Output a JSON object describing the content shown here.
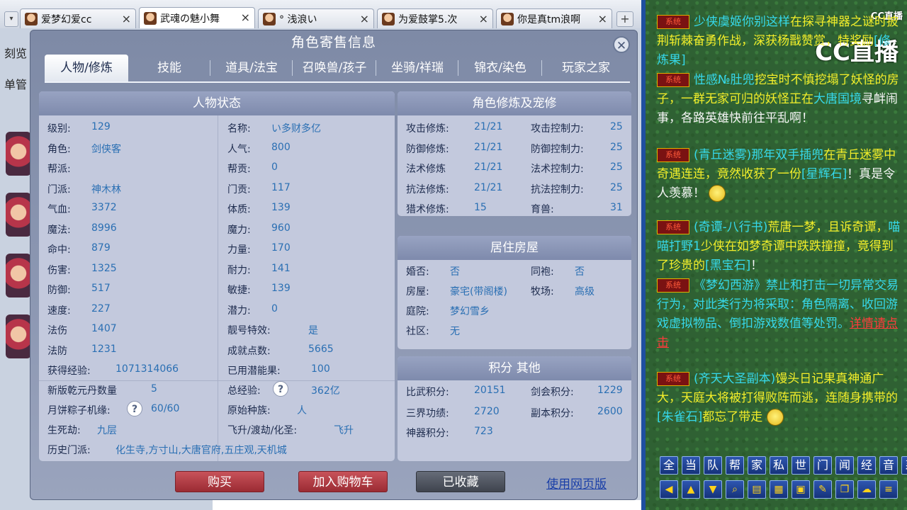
{
  "browser_tabs": [
    {
      "label": "爱梦幻爱cc",
      "active": false
    },
    {
      "label": "武魂の魅小舞",
      "active": true
    },
    {
      "label": "° 浅浪い",
      "active": false
    },
    {
      "label": "为爱鼓掌5.次",
      "active": false
    },
    {
      "label": "你是真tm浪啊",
      "active": false
    }
  ],
  "tab_nav": {
    "left": "▾",
    "new_tab": "+"
  },
  "left_strip": {
    "item1": "刻览",
    "item2": "单管"
  },
  "dialog": {
    "title": "角色寄售信息",
    "close": "✕",
    "tabs": [
      "人物/修炼",
      "技能",
      "道具/法宝",
      "召唤兽/孩子",
      "坐骑/祥瑞",
      "锦衣/染色",
      "玩家之家"
    ],
    "active_tab": 0
  },
  "status": {
    "header": "人物状态",
    "left": [
      {
        "label": "级别:",
        "value": "129"
      },
      {
        "label": "角色:",
        "value": "剑侠客"
      },
      {
        "label": "帮派:",
        "value": ""
      },
      {
        "label": "门派:",
        "value": "神木林"
      },
      {
        "label": "气血:",
        "value": "3372"
      },
      {
        "label": "魔法:",
        "value": "8996"
      },
      {
        "label": "命中:",
        "value": "879"
      },
      {
        "label": "伤害:",
        "value": "1325"
      },
      {
        "label": "防御:",
        "value": "517"
      },
      {
        "label": "速度:",
        "value": "227"
      },
      {
        "label": "法伤",
        "value": "1407"
      },
      {
        "label": "法防",
        "value": "1231"
      }
    ],
    "right": [
      {
        "label": "名称:",
        "value": "い多财多亿"
      },
      {
        "label": "人气:",
        "value": "800"
      },
      {
        "label": "帮贡:",
        "value": "0"
      },
      {
        "label": "门贡:",
        "value": "117"
      },
      {
        "label": "体质:",
        "value": "139"
      },
      {
        "label": "魔力:",
        "value": "960"
      },
      {
        "label": "力量:",
        "value": "170"
      },
      {
        "label": "耐力:",
        "value": "141"
      },
      {
        "label": "敏捷:",
        "value": "139"
      },
      {
        "label": "潜力:",
        "value": "0"
      },
      {
        "label": "靓号特效:",
        "value": "是"
      },
      {
        "label": "成就点数:",
        "value": "5665"
      }
    ],
    "exp_label": "获得经验:",
    "exp_value": "1071314066",
    "potion_label": "已用潜能果:",
    "potion_value": "100",
    "qiankun_label": "新版乾元丹数量",
    "qiankun_value": "5",
    "total_exp_label": "总经验:",
    "total_exp_value": "362亿",
    "mooncake_label": "月饼粽子机缘:",
    "mooncake_value": "60/60",
    "race_label": "原始种族:",
    "race_value": "人",
    "life_label": "生死劫:",
    "life_value": "九层",
    "fly_label": "飞升/渡劫/化圣:",
    "fly_value": "飞升",
    "history_label": "历史门派:",
    "history_value": "化生寺,方寸山,大唐官府,五庄观,天机城",
    "help": "?"
  },
  "cultivation": {
    "header": "角色修炼及宠修",
    "left": [
      {
        "label": "攻击修炼:",
        "value": "21/21"
      },
      {
        "label": "防御修炼:",
        "value": "21/21"
      },
      {
        "label": "法术修炼",
        "value": "21/21"
      },
      {
        "label": "抗法修炼:",
        "value": "21/21"
      },
      {
        "label": "猎术修炼:",
        "value": "15"
      }
    ],
    "right": [
      {
        "label": "攻击控制力:",
        "value": "25"
      },
      {
        "label": "防御控制力:",
        "value": "25"
      },
      {
        "label": "法术控制力:",
        "value": "25"
      },
      {
        "label": "抗法控制力:",
        "value": "25"
      },
      {
        "label": "育兽:",
        "value": "31"
      }
    ]
  },
  "house": {
    "header": "居住房屋",
    "married_label": "婚否:",
    "married_value": "否",
    "robe_label": "同袍:",
    "robe_value": "否",
    "house_label": "房屋:",
    "house_value": "豪宅(带阁楼)",
    "ranch_label": "牧场:",
    "ranch_value": "高级",
    "yard_label": "庭院:",
    "yard_value": "梦幻雪乡",
    "community_label": "社区:",
    "community_value": "无"
  },
  "points": {
    "header": "积分 其他",
    "pk_label": "比武积分:",
    "pk_value": "20151",
    "sword_label": "剑会积分:",
    "sword_value": "1229",
    "merit_label": "三界功绩:",
    "merit_value": "2720",
    "dungeon_label": "副本积分:",
    "dungeon_value": "2600",
    "artifact_label": "神器积分:",
    "artifact_value": "723"
  },
  "buttons": {
    "buy": "购买",
    "add_cart": "加入购物车",
    "favorited": "已收藏",
    "web_version": "使用网页版"
  },
  "chat": {
    "logo": "CC直播",
    "logo_small": "CC直播",
    "sys_tag": "系统",
    "m1": {
      "a": "少侠虞姬你别这样",
      "b": "在探寻神器之谜时披荆斩棘奋勇作战，深获杨戬赞赏，特奖励",
      "c": "[修炼果]"
    },
    "m2": {
      "a": "性感№肚兜",
      "b": "挖宝时不慎挖塌了妖怪的房子，一群无家可归的妖怪正在",
      "c": "大唐国境",
      "d": "寻衅闹事，各路英雄快前往平乱啊！"
    },
    "m3": {
      "a": "(青丘迷雾)",
      "b": "那年双手插兜",
      "c": "在青丘迷雾中奇遇连连，竟然收获了一份",
      "d": "[星辉石]",
      "e": "！真是令人羡慕！"
    },
    "m4": {
      "a": "(奇谭-八行书)",
      "b": "荒唐一梦，且诉奇谭，",
      "c": "喵喵打野1",
      "d": "少侠在如梦奇谭中跌跌撞撞，竟得到了珍贵的",
      "e": "[黑宝石]",
      "f": "！"
    },
    "m5": {
      "a": "《梦幻西游》禁止和打击一切异常交易行为，对此类行为将采取：角色隔离、收回游戏虚拟物品、倒扣游戏数值等处罚。",
      "b": "详情请点击"
    },
    "m6": {
      "a": "(齐天大圣副本)",
      "b": "馒头日记",
      "c": "果真神通广大，天庭大将被打得败阵而逃，连随身携带的",
      "d": "[朱雀石]",
      "e": "都忘了带走"
    },
    "channels": [
      "全",
      "当",
      "队",
      "帮",
      "家",
      "私",
      "世",
      "门",
      "闻",
      "经",
      "音",
      "系"
    ]
  }
}
